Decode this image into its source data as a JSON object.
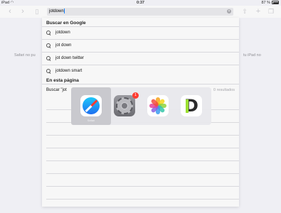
{
  "status_bar": {
    "device": "iPad",
    "time": "0:37",
    "battery": "87 %"
  },
  "toolbar": {
    "url_value": "jotdown"
  },
  "background_page": {
    "left_text": "Safari no pu",
    "right_text": "tu iPad no"
  },
  "suggestions": {
    "google_header": "Buscar en Google",
    "items": [
      {
        "label": "jotdown"
      },
      {
        "label": "jot down"
      },
      {
        "label": "jot down twitter"
      },
      {
        "label": "jotdown smart"
      }
    ],
    "on_page_header": "En esta página",
    "find_label": "Buscar \"jot",
    "find_count": "0 resultados"
  },
  "app_switcher": {
    "apps": [
      {
        "name": "Safari",
        "selected": true
      },
      {
        "name": "Ajustes",
        "badge": "1"
      },
      {
        "name": "Fotos"
      },
      {
        "name": "Day One"
      }
    ]
  },
  "colors": {
    "accent": "#1a82fb",
    "badge": "#ff3b30",
    "switcher_bg": "#e8e8ec"
  }
}
